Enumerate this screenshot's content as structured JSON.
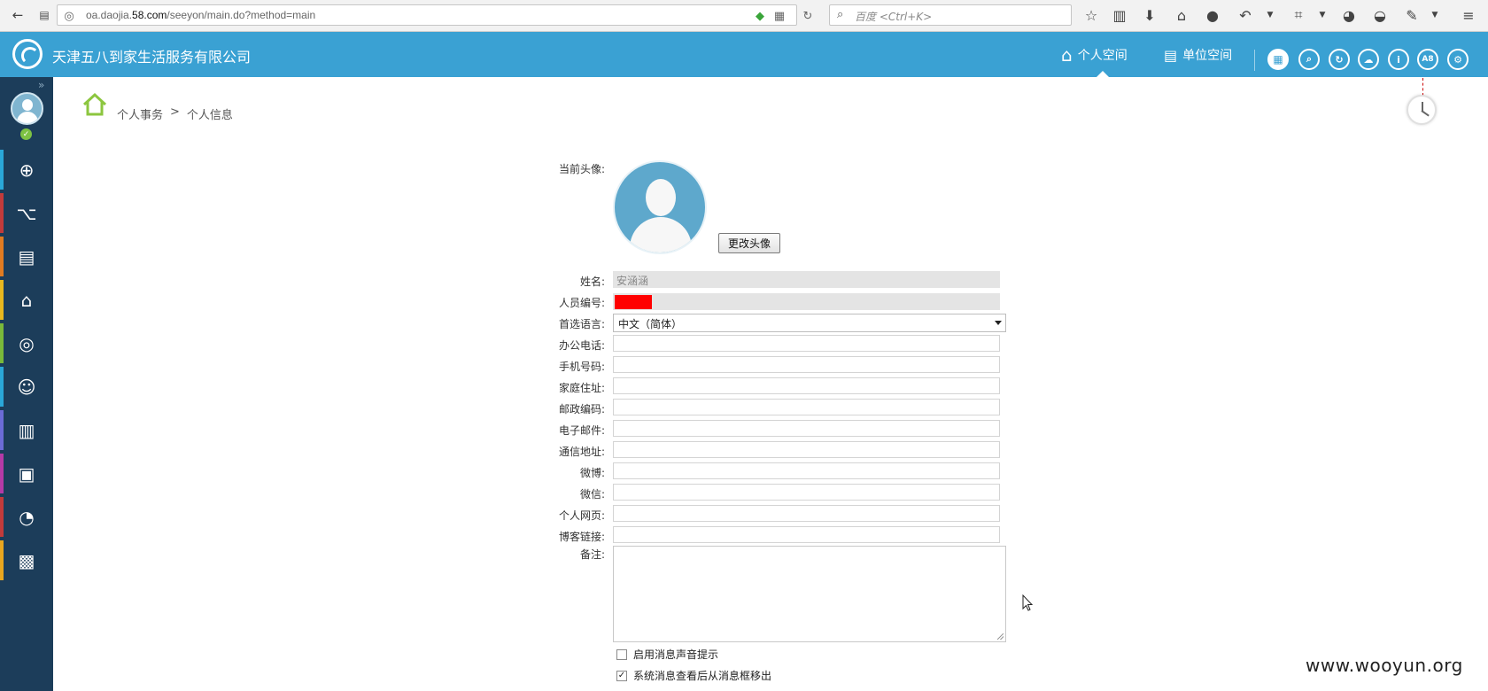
{
  "browser": {
    "url_prefix": "oa.daojia.",
    "url_domain": "58.com",
    "url_path": "/seeyon/main.do?method=main",
    "search_placeholder": "百度 <Ctrl+K>"
  },
  "header": {
    "company": "天津五八到家生活服务有限公司",
    "tabs": [
      {
        "label": "个人空间",
        "icon": "house-icon",
        "active": true
      },
      {
        "label": "单位空间",
        "icon": "building-icon",
        "active": false
      }
    ],
    "tools": [
      "grid-icon",
      "search-icon",
      "refresh-icon",
      "cloud-icon",
      "info-icon",
      "A8",
      "gear-icon"
    ],
    "tool_a8_text": "A8"
  },
  "sidebar": {
    "items": [
      {
        "icon": "plus-icon",
        "color": "#2aa7d8"
      },
      {
        "icon": "workflow-icon",
        "color": "#c23b3b"
      },
      {
        "icon": "calendar-icon",
        "color": "#e07b21"
      },
      {
        "icon": "chart-house-icon",
        "color": "#e8b81f"
      },
      {
        "icon": "target-icon",
        "color": "#79b93a"
      },
      {
        "icon": "contact-icon",
        "color": "#2aa7d8"
      },
      {
        "icon": "book-icon",
        "color": "#6b6bd6"
      },
      {
        "icon": "news-icon",
        "color": "#b43aa6"
      },
      {
        "icon": "gauge-icon",
        "color": "#c23b3b"
      },
      {
        "icon": "toolbox-icon",
        "color": "#e8a61f"
      }
    ]
  },
  "breadcrumb": {
    "level1": "个人事务",
    "separator": ">",
    "level2": "个人信息"
  },
  "form": {
    "avatar_label": "当前头像:",
    "change_avatar_button": "更改头像",
    "fields": [
      {
        "label": "姓名:",
        "value": "安涵涵",
        "readonly": true
      },
      {
        "label": "人员编号:",
        "value": "",
        "readonly": true
      },
      {
        "label": "首选语言:",
        "value": "中文（简体）"
      },
      {
        "label": "办公电话:",
        "value": ""
      },
      {
        "label": "手机号码:",
        "value": ""
      },
      {
        "label": "家庭住址:",
        "value": ""
      },
      {
        "label": "邮政编码:",
        "value": ""
      },
      {
        "label": "电子邮件:",
        "value": ""
      },
      {
        "label": "通信地址:",
        "value": ""
      },
      {
        "label": "微博:",
        "value": ""
      },
      {
        "label": "微信:",
        "value": ""
      },
      {
        "label": "个人网页:",
        "value": ""
      },
      {
        "label": "博客链接:",
        "value": ""
      },
      {
        "label": "备注:",
        "value": ""
      }
    ],
    "options": [
      {
        "label": "启用消息声音提示",
        "checked": false
      },
      {
        "label": "系统消息查看后从消息框移出",
        "checked": true
      }
    ]
  },
  "watermark": "www.wooyun.org"
}
